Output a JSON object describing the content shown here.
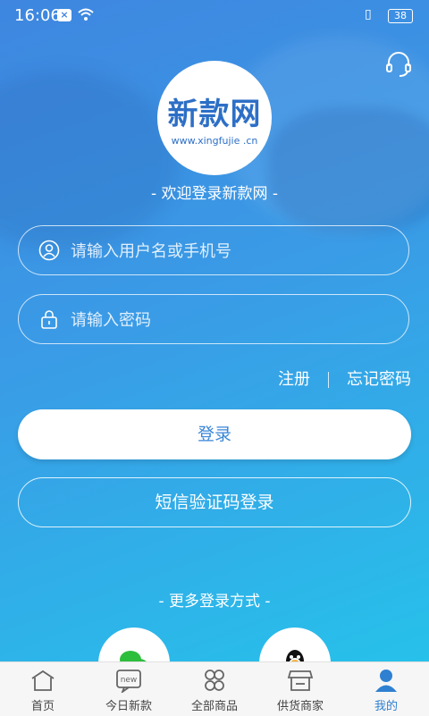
{
  "status_bar": {
    "time": "16:06",
    "battery": "38"
  },
  "logo": {
    "main": "新款网",
    "sub": "www.xingfujie .cn"
  },
  "welcome": "- 欢迎登录新款网 -",
  "username_field": {
    "placeholder": "请输入用户名或手机号"
  },
  "password_field": {
    "placeholder": "请输入密码"
  },
  "links": {
    "register": "注册",
    "forgot": "忘记密码"
  },
  "buttons": {
    "login": "登录",
    "sms_login": "短信验证码登录"
  },
  "more_login": "- 更多登录方式 -",
  "tabbar": {
    "items": [
      {
        "label": "首页",
        "icon": "home-icon"
      },
      {
        "label": "今日新款",
        "icon": "new-icon"
      },
      {
        "label": "全部商品",
        "icon": "grid-icon"
      },
      {
        "label": "供货商家",
        "icon": "store-icon"
      },
      {
        "label": "我的",
        "icon": "user-icon"
      }
    ],
    "active_index": 4
  },
  "colors": {
    "accent": "#2f80d1",
    "gradient_start": "#3e86e0",
    "gradient_end": "#27c1ea"
  }
}
